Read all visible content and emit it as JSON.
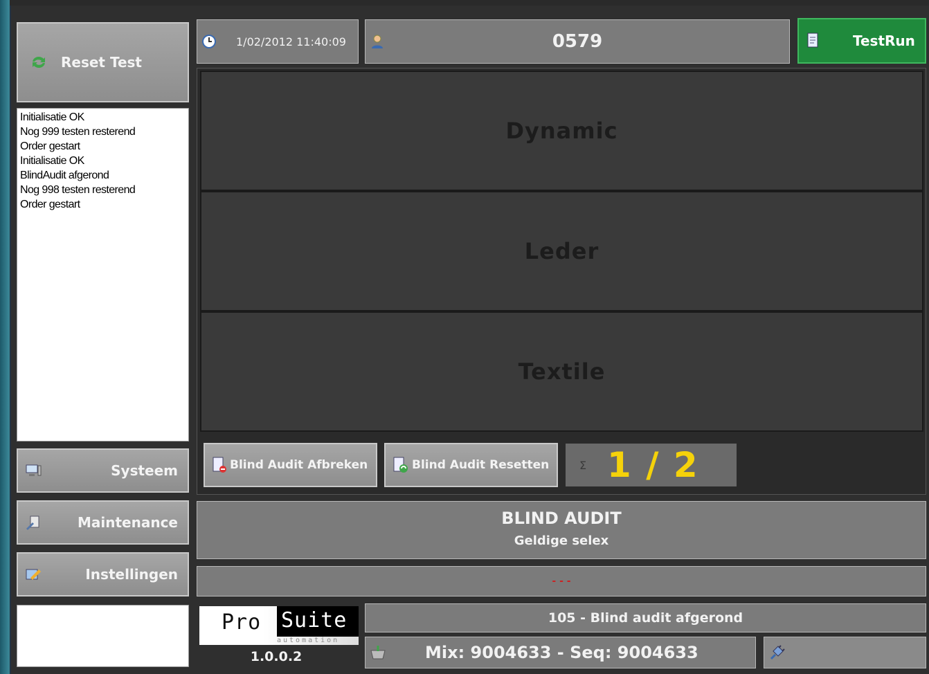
{
  "left": {
    "reset_label": "Reset Test",
    "log": [
      "Initialisatie OK",
      "Nog 999 testen resterend",
      "Order gestart",
      "Initialisatie OK",
      "BlindAudit afgerond",
      "Nog 998 testen resterend",
      "Order gestart"
    ],
    "nav": [
      {
        "label": "Systeem",
        "icon": "computer-icon"
      },
      {
        "label": "Maintenance",
        "icon": "tools-icon"
      },
      {
        "label": "Instellingen",
        "icon": "settings-icon"
      }
    ]
  },
  "header": {
    "datetime": "1/02/2012 11:40:09",
    "operator": "0579",
    "testrun_label": "TestRun"
  },
  "categories": [
    "Dynamic",
    "Leder",
    "Textile"
  ],
  "actions": {
    "abort_label": "Blind Audit Afbreken",
    "reset_label": "Blind Audit Resetten",
    "counter": "1 / 2",
    "counter_icon": "sigma-icon"
  },
  "status": {
    "title": "BLIND AUDIT",
    "subtitle": "Geldige selex",
    "message": "- - -",
    "event": "105 - Blind audit afgerond",
    "mix_seq": "Mix: 9004633 - Seq: 9004633"
  },
  "brand": {
    "pro": "Pro",
    "suite": "Suite",
    "tagline": "automation",
    "version": "1.0.0.2"
  },
  "colors": {
    "accent_green": "#1f8a3c",
    "counter_yellow": "#f5d20a",
    "message_red": "#cc2222"
  }
}
